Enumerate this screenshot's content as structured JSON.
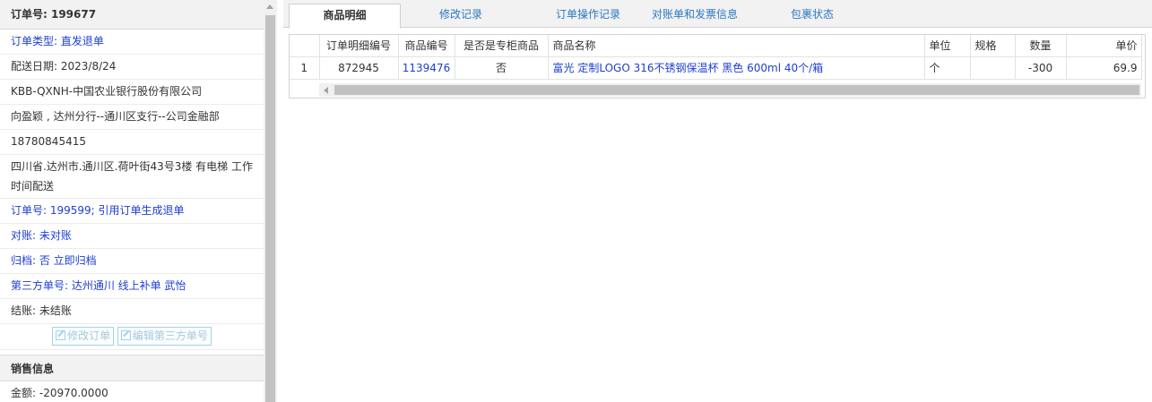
{
  "order": {
    "title": "订单号: 199677",
    "rows": [
      {
        "text": "订单类型: 直发退单"
      },
      {
        "text": "配送日期: 2023/8/24"
      },
      {
        "text": "KBB-QXNH-中国农业银行股份有限公司"
      },
      {
        "text": "向盈颖 , 达州分行--通川区支行--公司金融部"
      },
      {
        "text": "18780845415"
      },
      {
        "text": "四川省.达州市.通川区.荷叶街43号3楼 有电梯 工作时间配送"
      },
      {
        "text": "订单号: 199599; 引用订单生成退单"
      },
      {
        "text": "对账: 未对账"
      },
      {
        "text": "归档:  否 立即归档"
      },
      {
        "text": "第三方单号: 达州通川 线上补单 武怡"
      },
      {
        "text": "结账: 未结账"
      }
    ],
    "edit_order_label": "修改订单",
    "edit_third_party_label": "编辑第三方单号"
  },
  "sales": {
    "title": "销售信息",
    "amount": "金额: -20970.0000"
  },
  "tabs": [
    {
      "label": "商品明细",
      "active": true
    },
    {
      "label": "修改记录",
      "active": false
    },
    {
      "label": "订单操作记录",
      "active": false
    },
    {
      "label": "对账单和发票信息",
      "active": false
    },
    {
      "label": "包裹状态",
      "active": false
    }
  ],
  "grid": {
    "columns": [
      "订单明细编号",
      "商品编号",
      "是否是专柜商品",
      "商品名称",
      "单位",
      "规格",
      "数量",
      "单价"
    ],
    "rows": [
      {
        "row_num": "1",
        "detail_no": "872945",
        "product_no": "1139476",
        "is_counter": "否",
        "product_name": "富光 定制LOGO 316不锈钢保温杯 黑色 600ml 40个/箱",
        "unit": "个",
        "spec": "",
        "qty": "-300",
        "price": "69.9"
      }
    ]
  },
  "colors": {
    "link_blue": "#1d3fd0",
    "tab_blue": "#2b78c2",
    "disabled_button": "#a5c9dc"
  }
}
